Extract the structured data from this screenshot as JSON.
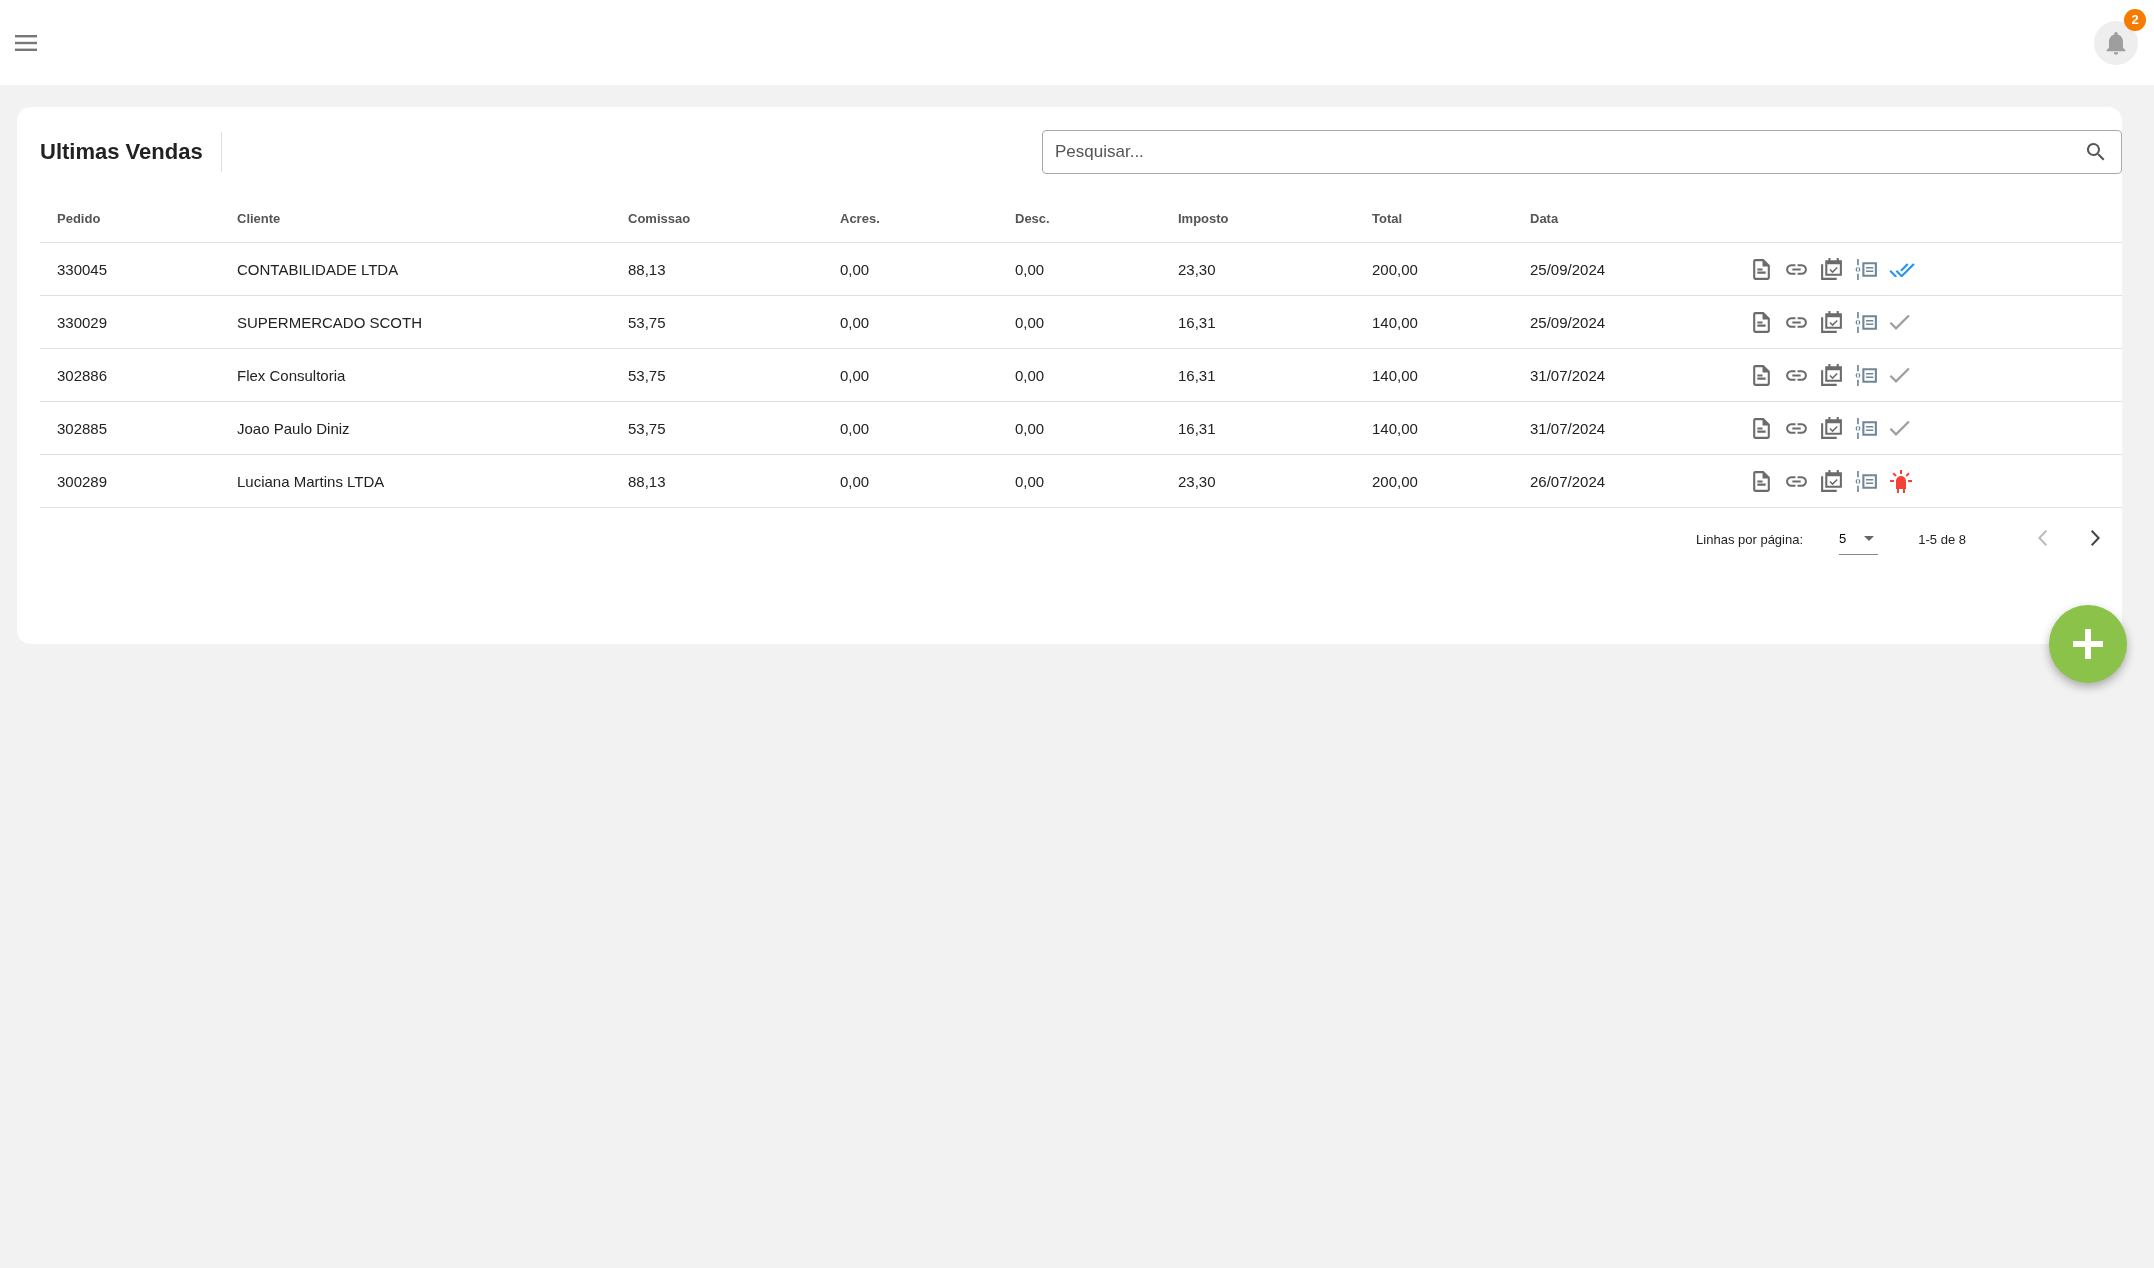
{
  "header": {
    "notifications": "2"
  },
  "card": {
    "title": "Ultimas Vendas",
    "search": {
      "placeholder": "Pesquisar..."
    }
  },
  "table": {
    "columns": [
      "Pedido",
      "Cliente",
      "Comissao",
      "Acres.",
      "Desc.",
      "Imposto",
      "Total",
      "Data"
    ],
    "rows": [
      {
        "cells": [
          "330045",
          "CONTABILIDADE LTDA",
          "88,13",
          "0,00",
          "0,00",
          "23,30",
          "200,00",
          "25/09/2024"
        ],
        "kind": "double-check"
      },
      {
        "cells": [
          "330029",
          "SUPERMERCADO SCOTH",
          "53,75",
          "0,00",
          "0,00",
          "16,31",
          "140,00",
          "25/09/2024"
        ],
        "kind": "check"
      },
      {
        "cells": [
          "302886",
          "Flex Consultoria",
          "53,75",
          "0,00",
          "0,00",
          "16,31",
          "140,00",
          "31/07/2024"
        ],
        "kind": "check"
      },
      {
        "cells": [
          "302885",
          "Joao Paulo Diniz",
          "53,75",
          "0,00",
          "0,00",
          "16,31",
          "140,00",
          "31/07/2024"
        ],
        "kind": "check"
      },
      {
        "cells": [
          "300289",
          "Luciana Martins LTDA",
          "88,13",
          "0,00",
          "0,00",
          "23,30",
          "200,00",
          "26/07/2024"
        ],
        "kind": "alert"
      }
    ]
  },
  "pagination": {
    "rows_per_page_label": "Linhas por página:",
    "rows_per_page": "5",
    "range": "1-5 de 8",
    "previous_disabled": true,
    "next_disabled": false
  }
}
